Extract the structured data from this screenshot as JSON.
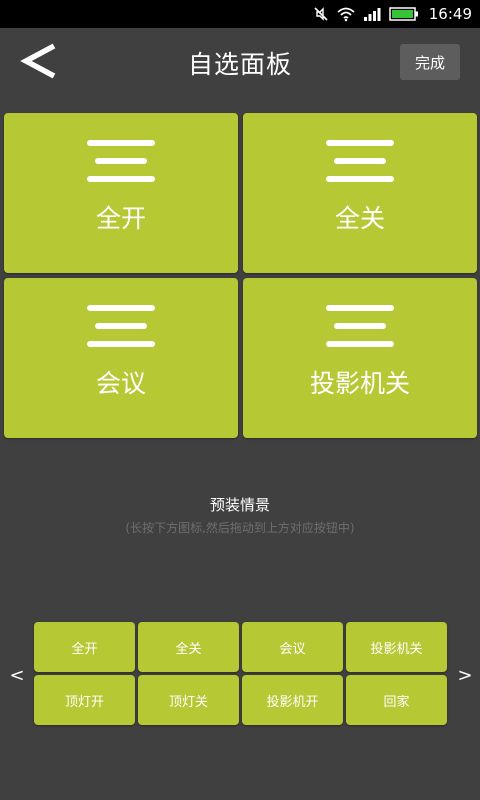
{
  "status_bar": {
    "time": "16:49",
    "icons": [
      "mute-icon",
      "wifi-icon",
      "signal-icon",
      "battery-icon"
    ]
  },
  "header": {
    "title": "自选面板",
    "back_icon": "chevron-left-icon",
    "done_label": "完成"
  },
  "tiles": [
    {
      "label": "全开",
      "icon": "menu-lines-icon"
    },
    {
      "label": "全关",
      "icon": "menu-lines-icon"
    },
    {
      "label": "会议",
      "icon": "menu-lines-icon"
    },
    {
      "label": "投影机关",
      "icon": "menu-lines-icon"
    }
  ],
  "preset": {
    "title": "预装情景",
    "hint": "(长按下方图标,然后拖动到上方对应按钮中)",
    "prev_label": "<",
    "next_label": ">",
    "buttons": [
      {
        "label": "全开"
      },
      {
        "label": "全关"
      },
      {
        "label": "会议"
      },
      {
        "label": "投影机关"
      },
      {
        "label": "顶灯开"
      },
      {
        "label": "顶灯关"
      },
      {
        "label": "投影机开"
      },
      {
        "label": "回家"
      }
    ]
  },
  "colors": {
    "background": "#414040",
    "tile": "#b7c835",
    "status_bar": "#000000",
    "battery": "#35c435",
    "done_button": "#5e5d5d",
    "hint_text": "#6f6e6e"
  }
}
